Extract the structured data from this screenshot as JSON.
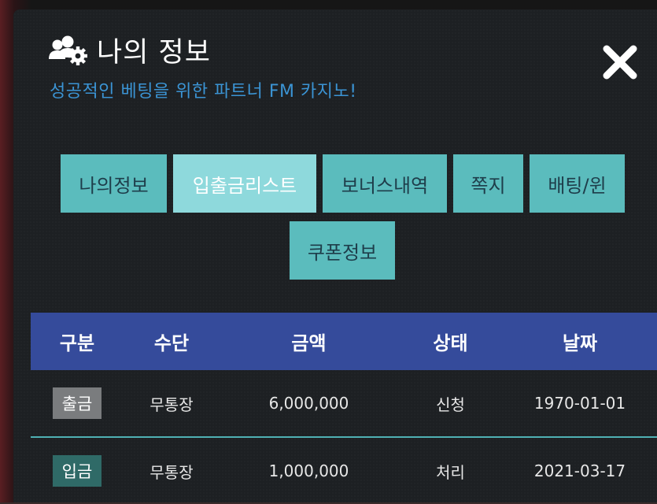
{
  "header": {
    "title": "나의 정보",
    "subtitle": "성공적인 베팅을 위한 파트너 FM 카지노!"
  },
  "tabs": [
    {
      "label": "나의정보",
      "active": false
    },
    {
      "label": "입출금리스트",
      "active": true
    },
    {
      "label": "보너스내역",
      "active": false
    },
    {
      "label": "쪽지",
      "active": false
    },
    {
      "label": "배팅/윈",
      "active": false
    },
    {
      "label": "쿠폰정보",
      "active": false
    }
  ],
  "table": {
    "columns": [
      "구분",
      "수단",
      "금액",
      "상태",
      "날짜"
    ],
    "rows": [
      {
        "type": "출금",
        "method": "무통장",
        "amount": "6,000,000",
        "status": "신청",
        "date": "1970-01-01"
      },
      {
        "type": "입금",
        "method": "무통장",
        "amount": "1,000,000",
        "status": "처리",
        "date": "2021-03-17"
      }
    ]
  },
  "colors": {
    "accent_blue": "#3b94d4",
    "tab_bg": "#5bbcbd",
    "tab_active_bg": "#8ed9dc",
    "table_header_bg": "#354b9b",
    "badge_withdraw": "#7a7c7e",
    "badge_deposit": "#2f6a67"
  },
  "icons": {
    "title_icon": "users-gear-icon",
    "close_icon": "close-icon"
  }
}
